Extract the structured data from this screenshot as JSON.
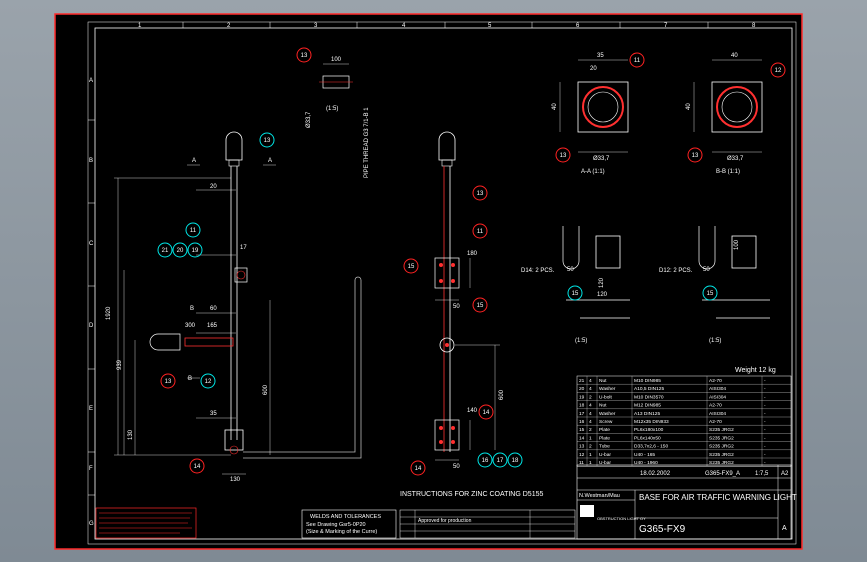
{
  "colors": {
    "background": "#000000",
    "border": "#ff2a2a",
    "frame": "#ffffff",
    "balloon_red": "#ff2222",
    "balloon_cyan": "#00e5e5",
    "balloon_text": "#ffffff",
    "line_red": "#ff3030",
    "text": "#ffffff"
  },
  "column_numbers": [
    "1",
    "2",
    "3",
    "4",
    "5",
    "6",
    "7",
    "8"
  ],
  "row_letters": [
    "A",
    "B",
    "C",
    "D",
    "E",
    "F",
    "G"
  ],
  "balloons": {
    "b13": "13",
    "b11": "11",
    "b12": "12",
    "b15": "15",
    "b16": "16",
    "b17": "17",
    "b18": "18",
    "b14": "14",
    "b19": "19",
    "b20": "20",
    "b21": "21"
  },
  "section_labels": {
    "aa": "A-A (1:1)",
    "bb": "B-B (1:1)",
    "scale_15": "(1:5)",
    "section_a": "A",
    "section_b": "B"
  },
  "dimensions": {
    "d100": "100",
    "d1920": "1920",
    "d35": "35",
    "d40": "40",
    "d20": "20",
    "d17": "17",
    "d60": "60",
    "d165": "165",
    "d300": "300",
    "d939": "939",
    "d600": "600",
    "d130": "130",
    "d180": "180",
    "d140": "140",
    "d50": "50",
    "d120": "120",
    "d4": "4",
    "d12": "12",
    "d_dia": "Ø33,7",
    "d_pipe": "PIPE THREAD G3 7/1-B 1"
  },
  "notes": {
    "weld_title": "WELDS AND TOLERANCES",
    "weld_line1": "See Drawing   Gsr5-0P20",
    "weld_line2": "(Size & Marking of the Curre)",
    "zinc": "INSTRUCTIONS FOR ZINC COATING D5155",
    "weight": "Weight 12 kg",
    "dia12_left": "D14: 2 PCS.",
    "dia12_right": "D12: 2 PCS.",
    "rev_note": "Approved for production"
  },
  "parts_list": [
    [
      "21",
      "4",
      "Nut",
      "M10 DIN985",
      "A2-70",
      "-"
    ],
    [
      "20",
      "4",
      "Washer",
      "A10,5 DIN125",
      "AISI304",
      "-"
    ],
    [
      "19",
      "2",
      "U-bolt",
      "M10 DIN3570",
      "AISI304",
      "-"
    ],
    [
      "18",
      "4",
      "Nut",
      "M12 DIN985",
      "A2-70",
      "-"
    ],
    [
      "17",
      "4",
      "Washer",
      "A13 DIN125",
      "AISI304",
      "-"
    ],
    [
      "16",
      "4",
      "Screw",
      "M12x35 DIN933",
      "A2-70",
      "-"
    ],
    [
      "15",
      "2",
      "Plate",
      "PL6x180x100",
      "S235 JRG2",
      "-"
    ],
    [
      "14",
      "1",
      "Plate",
      "PL6x140x50",
      "S235 JRG2",
      "-"
    ],
    [
      "13",
      "2",
      "Tube",
      "D33,7x2,6 - 150",
      "S235 JRG2",
      "-"
    ],
    [
      "12",
      "1",
      "U-bar",
      "U40 - 165",
      "S235 JRG2",
      "-"
    ],
    [
      "11",
      "1",
      "U-bar",
      "U40 - 1960",
      "S235 JRG2",
      "-"
    ]
  ],
  "title_block": {
    "date": "18.02.2002",
    "file": "G365-FX9_A",
    "scale": "1:7,5",
    "size": "A2",
    "drawn": "N.Westman/Mau",
    "title": "BASE FOR AIR TRAFFIC WARNING LIGHT",
    "number": "G365-FX9",
    "revision": "A",
    "company": "OBSTRUCTION LIGHT OY"
  }
}
